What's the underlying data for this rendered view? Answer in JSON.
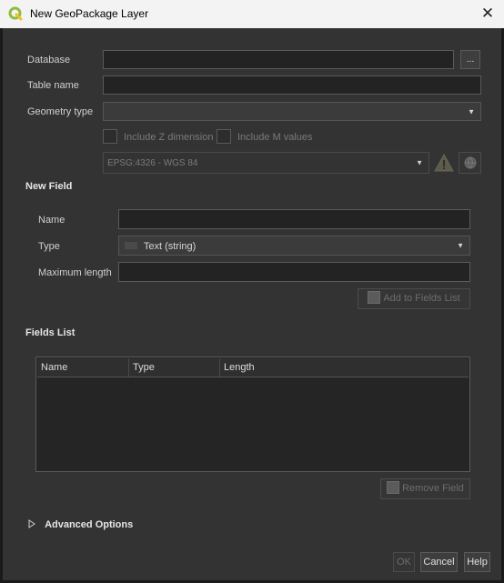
{
  "window": {
    "title": "New GeoPackage Layer",
    "close_glyph": "✕"
  },
  "form": {
    "database_label": "Database",
    "database_value": "",
    "browse_label": "...",
    "table_name_label": "Table name",
    "table_name_value": "",
    "geometry_type_label": "Geometry type",
    "geometry_type_value": "",
    "include_z_label": "Include Z dimension",
    "include_m_label": "Include M values",
    "crs_value": "EPSG:4326 - WGS 84"
  },
  "new_field": {
    "section_label": "New Field",
    "name_label": "Name",
    "name_value": "",
    "type_label": "Type",
    "type_value": "Text (string)",
    "max_length_label": "Maximum length",
    "max_length_value": "",
    "add_button_label": "Add to Fields List"
  },
  "fields_list": {
    "section_label": "Fields List",
    "columns": [
      "Name",
      "Type",
      "Length"
    ],
    "rows": [],
    "remove_button_label": "Remove Field"
  },
  "advanced": {
    "label": "Advanced Options"
  },
  "buttons": {
    "ok": "OK",
    "cancel": "Cancel",
    "help": "Help"
  },
  "icons": {
    "app": "qgis-logo-icon",
    "warning": "warning-icon",
    "crs_select": "globe-icon",
    "expand": "triangle-right-icon"
  },
  "colors": {
    "accent_green": "#8fbc3f",
    "warning": "#e0b020"
  }
}
